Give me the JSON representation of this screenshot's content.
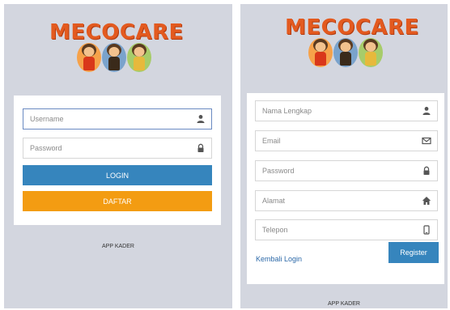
{
  "login": {
    "logo_text": "MECOCARE",
    "username_placeholder": "Username",
    "password_placeholder": "Password",
    "login_button": "LOGIN",
    "daftar_button": "DAFTAR",
    "footer": "APP KADER",
    "icons": {
      "username": "user-icon",
      "password": "lock-icon"
    }
  },
  "register": {
    "logo_text": "MECOCARE",
    "nama_placeholder": "Nama Lengkap",
    "email_placeholder": "Email",
    "password_placeholder": "Password",
    "alamat_placeholder": "Alamat",
    "telepon_placeholder": "Telepon",
    "back_link": "Kembali Login",
    "register_button": "Register",
    "footer": "APP KADER",
    "icons": {
      "nama": "user-icon",
      "email": "envelope-icon",
      "password": "lock-icon",
      "alamat": "home-icon",
      "telepon": "phone-icon"
    }
  },
  "colors": {
    "background": "#d3d6df",
    "primary": "#3685bd",
    "accent": "#f39c12",
    "logo": "#e35a1f"
  }
}
